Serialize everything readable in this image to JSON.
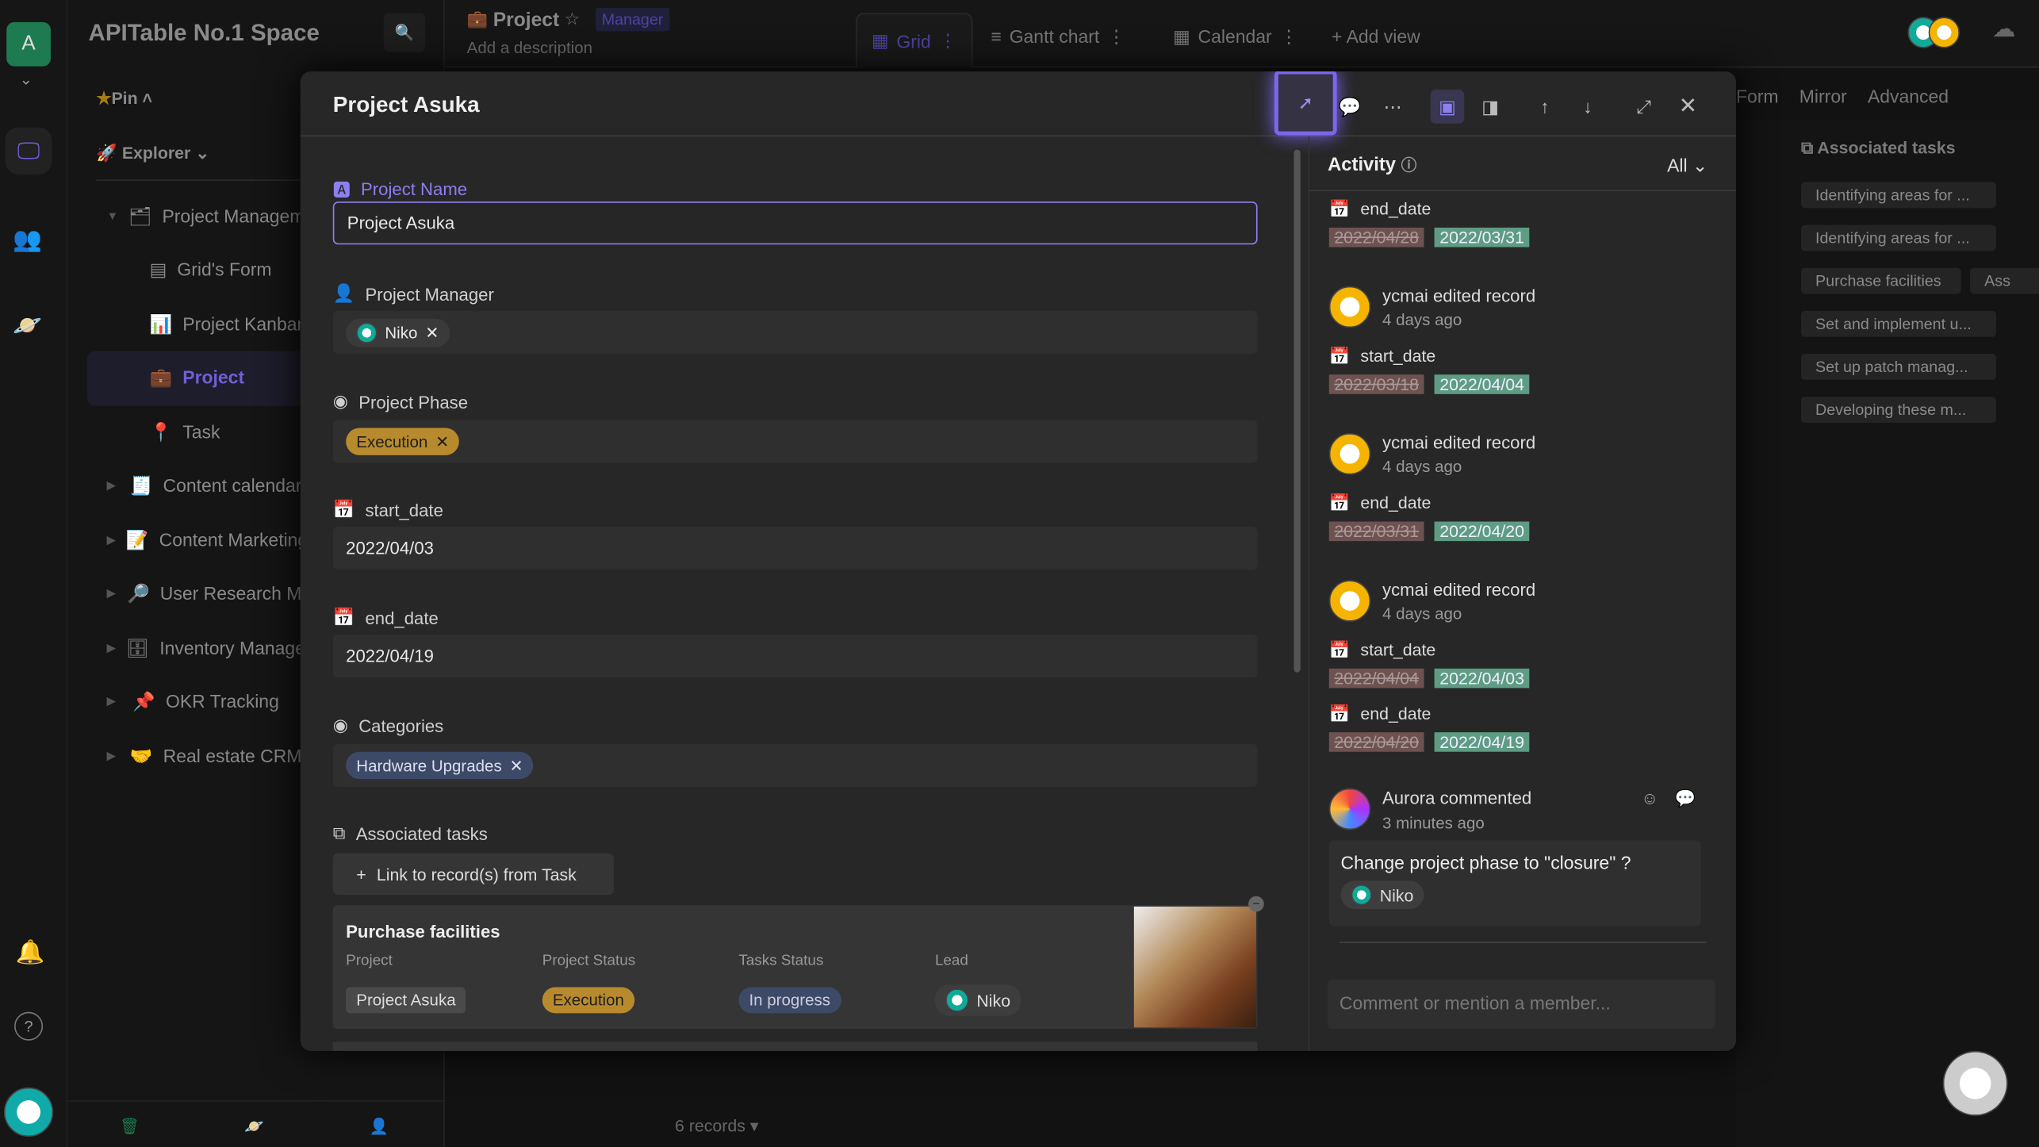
{
  "rail": {
    "space_initial": "A"
  },
  "sidebar": {
    "space_name": "APITable No.1 Space",
    "pin": "Pin",
    "explorer": "Explorer",
    "items": [
      {
        "label": "Project Management",
        "icon": "folder-icon"
      },
      {
        "label": "Grid's Form",
        "icon": "form-icon"
      },
      {
        "label": "Project Kanban",
        "icon": "chart-icon"
      },
      {
        "label": "Project",
        "icon": "briefcase-icon"
      },
      {
        "label": "Task",
        "icon": "pin-icon"
      },
      {
        "label": "Content calendar",
        "icon": "receipt-icon"
      },
      {
        "label": "Content Marketing",
        "icon": "memo-icon"
      },
      {
        "label": "User Research M",
        "icon": "magnifier-icon"
      },
      {
        "label": "Inventory Manage",
        "icon": "cabinet-icon"
      },
      {
        "label": "OKR Tracking",
        "icon": "pushpin-icon"
      },
      {
        "label": "Real estate CRM",
        "icon": "handshake-icon"
      }
    ]
  },
  "header": {
    "title": "Project",
    "role": "Manager",
    "description": "Add a description",
    "views": [
      "Grid",
      "Gantt chart",
      "Calendar"
    ],
    "add_view": "Add view",
    "toolbar": [
      "Form",
      "Mirror",
      "Advanced"
    ]
  },
  "grid": {
    "column": "Associated tasks",
    "cells": [
      "Identifying areas for ...",
      "Identifying areas for ...",
      "Purchase facilities",
      "Set and implement u...",
      "Set up patch manag...",
      "Developing these m..."
    ],
    "extra": "Ass"
  },
  "footer": {
    "records": "6 records ▾"
  },
  "modal": {
    "title": "Project Asuka",
    "fields": {
      "name_label": "Project Name",
      "name_value": "Project Asuka",
      "manager_label": "Project Manager",
      "manager_value": "Niko",
      "phase_label": "Project Phase",
      "phase_value": "Execution",
      "start_label": "start_date",
      "start_value": "2022/04/03",
      "end_label": "end_date",
      "end_value": "2022/04/19",
      "categories_label": "Categories",
      "categories_value": "Hardware Upgrades",
      "tasks_label": "Associated tasks",
      "link_button": "Link to record(s) from Task"
    },
    "task_card": {
      "title": "Purchase facilities",
      "headers": [
        "Project",
        "Project Status",
        "Tasks Status",
        "Lead"
      ],
      "project": "Project Asuka",
      "status": "Execution",
      "tasks_status": "In progress",
      "lead": "Niko"
    },
    "activity": {
      "title": "Activity",
      "filter": "All",
      "top_change": {
        "field": "end_date",
        "old": "2022/04/28",
        "new": "2022/03/31"
      },
      "entries": [
        {
          "user": "ycmai edited record",
          "time": "4 days ago",
          "changes": [
            {
              "field": "start_date",
              "old": "2022/03/18",
              "new": "2022/04/04"
            }
          ]
        },
        {
          "user": "ycmai edited record",
          "time": "4 days ago",
          "changes": [
            {
              "field": "end_date",
              "old": "2022/03/31",
              "new": "2022/04/20"
            }
          ]
        },
        {
          "user": "ycmai edited record",
          "time": "4 days ago",
          "changes": [
            {
              "field": "start_date",
              "old": "2022/04/04",
              "new": "2022/04/03"
            },
            {
              "field": "end_date",
              "old": "2022/04/20",
              "new": "2022/04/19"
            }
          ]
        }
      ],
      "comment": {
        "user": "Aurora commented",
        "time": "3 minutes ago",
        "text": "Change project phase to \"closure\" ?",
        "mention": "Niko"
      },
      "input_placeholder": "Comment or mention a member..."
    }
  },
  "colors": {
    "accent": "#7b67ee",
    "execution": "#b88a2e",
    "in_progress": "#3c4a68",
    "old": "#6e5250",
    "new": "#5e9c83"
  }
}
